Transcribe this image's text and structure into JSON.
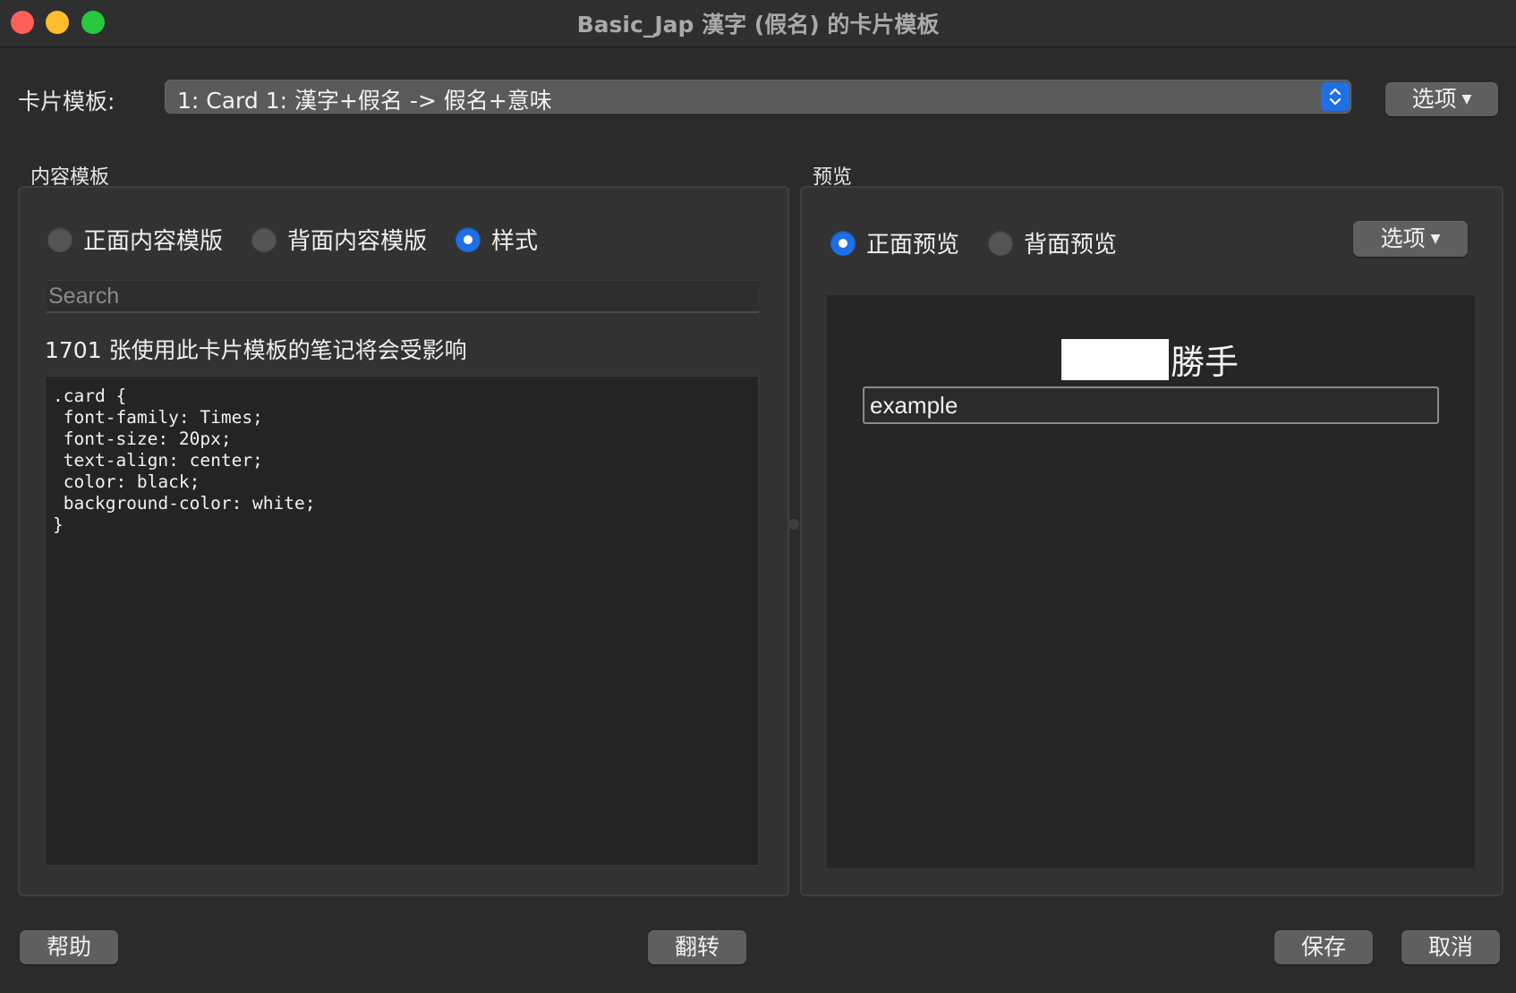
{
  "window": {
    "title": "Basic_Jap 漢字 (假名) 的卡片模板"
  },
  "card_template": {
    "label": "卡片模板:",
    "selected": "1: Card 1: 漢字+假名 -> 假名+意味",
    "options_label": "选项"
  },
  "content_template": {
    "group_title": "内容模板",
    "radios": [
      {
        "label": "正面内容模版",
        "selected": false
      },
      {
        "label": "背面内容模版",
        "selected": false
      },
      {
        "label": "样式",
        "selected": true
      }
    ],
    "search_placeholder": "Search",
    "affected_notes": "1701 张使用此卡片模板的笔记将会受影响",
    "css_code": ".card {\n font-family: Times;\n font-size: 20px;\n text-align: center;\n color: black;\n background-color: white;\n}"
  },
  "preview": {
    "group_title": "预览",
    "radios": [
      {
        "label": "正面预览",
        "selected": true
      },
      {
        "label": "背面预览",
        "selected": false
      }
    ],
    "options_label": "选项",
    "front_kanji": "勝手",
    "answer_input_value": "example"
  },
  "footer": {
    "help": "帮助",
    "flip": "翻转",
    "save": "保存",
    "cancel": "取消"
  },
  "colors": {
    "accent": "#1f6fe5",
    "background": "#2b2b2b"
  }
}
